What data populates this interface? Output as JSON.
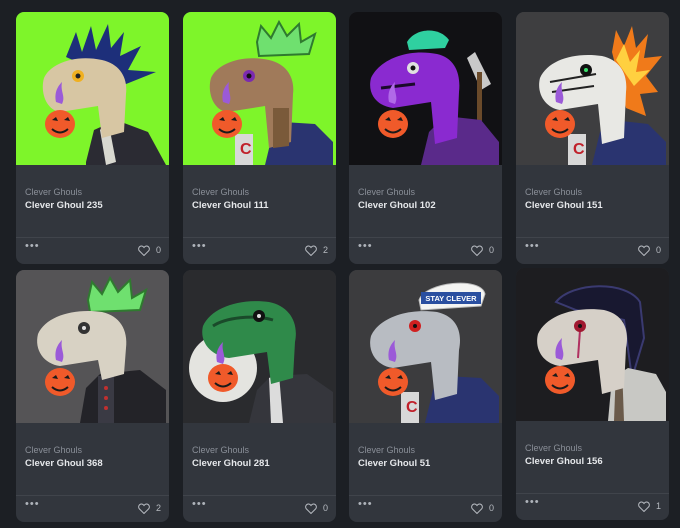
{
  "cards": [
    {
      "collection": "Clever Ghouls",
      "name": "Clever Ghoul 235",
      "likes": "0",
      "bg": "#7ef52a",
      "icon": "options-icon",
      "accessory": "spiky-hair"
    },
    {
      "collection": "Clever Ghouls",
      "name": "Clever Ghoul 111",
      "likes": "2",
      "bg": "#7ef52a",
      "icon": "options-icon",
      "accessory": "green-crown"
    },
    {
      "collection": "Clever Ghouls",
      "name": "Clever Ghoul 102",
      "likes": "0",
      "bg": "#111114",
      "icon": "options-icon",
      "accessory": "axe"
    },
    {
      "collection": "Clever Ghouls",
      "name": "Clever Ghoul 151",
      "likes": "0",
      "bg": "#3e3e40",
      "icon": "options-icon",
      "accessory": "flames"
    },
    {
      "collection": "Clever Ghouls",
      "name": "Clever Ghoul 368",
      "likes": "2",
      "bg": "#555456",
      "icon": "options-icon",
      "accessory": "green-crown"
    },
    {
      "collection": "Clever Ghouls",
      "name": "Clever Ghoul 281",
      "likes": "0",
      "bg": "#2a2b2e",
      "icon": "options-icon",
      "accessory": "moon"
    },
    {
      "collection": "Clever Ghouls",
      "name": "Clever Ghoul 51",
      "likes": "0",
      "bg": "#3c3c3e",
      "icon": "options-icon",
      "accessory": "sailor-hat"
    },
    {
      "collection": "Clever Ghouls",
      "name": "Clever Ghoul 156",
      "likes": "1",
      "bg": "#1d1d20",
      "icon": "options-icon",
      "accessory": "dark-hair"
    }
  ],
  "ui": {
    "more_label": "•••"
  },
  "hat_text": "STAY CLEVER"
}
